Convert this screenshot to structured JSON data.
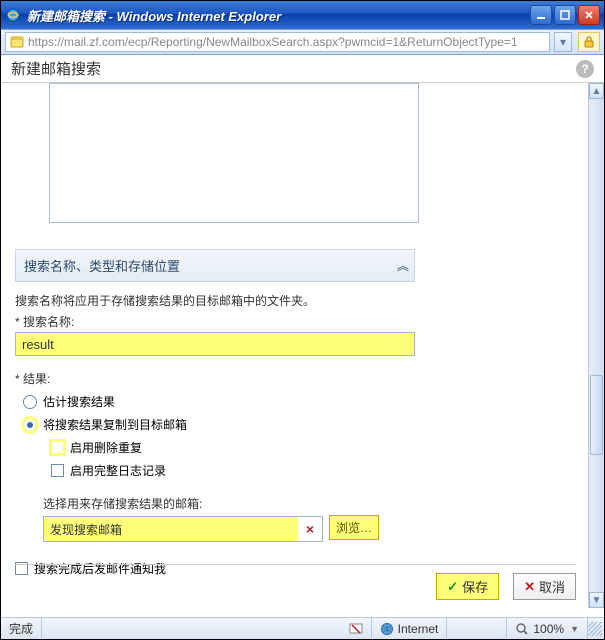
{
  "window": {
    "title": "新建邮箱搜索 - Windows Internet Explorer"
  },
  "address": {
    "url": "https://mail.zf.com/ecp/Reporting/NewMailboxSearch.aspx?pwmcid=1&ReturnObjectType=1"
  },
  "page": {
    "heading": "新建邮箱搜索"
  },
  "section": {
    "header": "搜索名称、类型和存储位置",
    "description": "搜索名称将应用于存储搜索结果的目标邮箱中的文件夹。",
    "name_label": "* 搜索名称:",
    "name_value": "result",
    "result_label": "* 结果:",
    "radio_estimate": "估计搜索结果",
    "radio_copy": "将搜索结果复制到目标邮箱",
    "cb_enable_dedup": "启用删除重复",
    "cb_enable_fulllog": "启用完整日志记录",
    "target_label": "选择用来存储搜索结果的邮箱:",
    "target_value": "发现搜索邮箱",
    "browse_label": "浏览…",
    "clear_icon": "×",
    "cb_notify": "搜索完成后发邮件通知我"
  },
  "footer": {
    "save": "保存",
    "cancel": "取消",
    "check": "✓",
    "cross": "✕"
  },
  "status": {
    "done": "完成",
    "zone": "Internet",
    "zoom": "100%"
  }
}
